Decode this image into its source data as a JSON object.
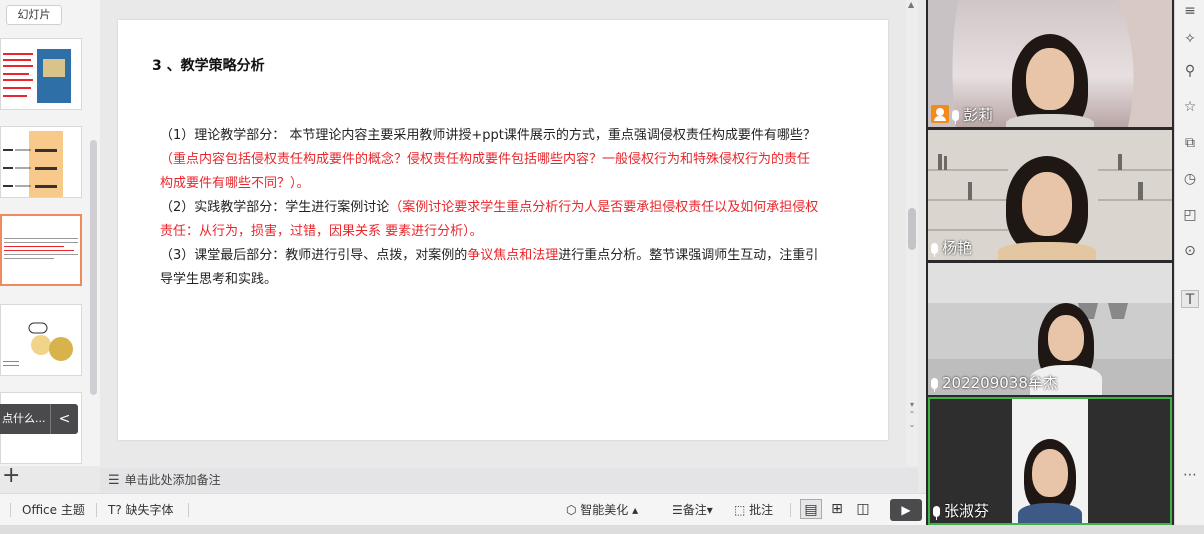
{
  "thumbnails": {
    "tab_label": "幻灯片",
    "tip_text": "点什么...",
    "tip_arrow": "<",
    "add_slide": "+"
  },
  "slide": {
    "title": "3 、教学策略分析",
    "p1_intro": "（1）理论教学部分： 本节理论内容主要采用教师讲授+ppt课件展示的方式，重点强调侵权责任构成要件有哪些？",
    "p1_red": "（重点内容包括侵权责任构成要件的概念？侵权责任构成要件包括哪些内容？一般侵权行为和特殊侵权行为的责任构成要件有哪些不同？）。",
    "p2_intro": "（2）实践教学部分：学生进行案例讨论",
    "p2_red": "（案例讨论要求学生重点分析行为人是否要承担侵权责任以及如何承担侵权责任：从行为，损害，过错，因果关系 要素进行分析）。",
    "p3_a": "（3）课堂最后部分：教师进行引导、点拨，对案例的",
    "p3_red": "争议焦点和法理",
    "p3_b": "进行重点分析。整节课强调师生互动，注重引导学生思考和实践。"
  },
  "notes": {
    "placeholder": "单击此处添加备注"
  },
  "statusbar": {
    "theme": "Office 主题",
    "missing_font": "缺失字体",
    "beautify": "智能美化",
    "notes": "备注",
    "comment": "批注"
  },
  "participants": [
    {
      "name": "彭莉",
      "host": true
    },
    {
      "name": "杨艳",
      "host": false
    },
    {
      "name": "202209038牟杰",
      "host": false
    },
    {
      "name": "张淑芬",
      "host": false
    }
  ],
  "colors": {
    "accent_red": "#e8262b",
    "host_orange": "#f28b1b",
    "thumb_active": "#f08a5d"
  }
}
